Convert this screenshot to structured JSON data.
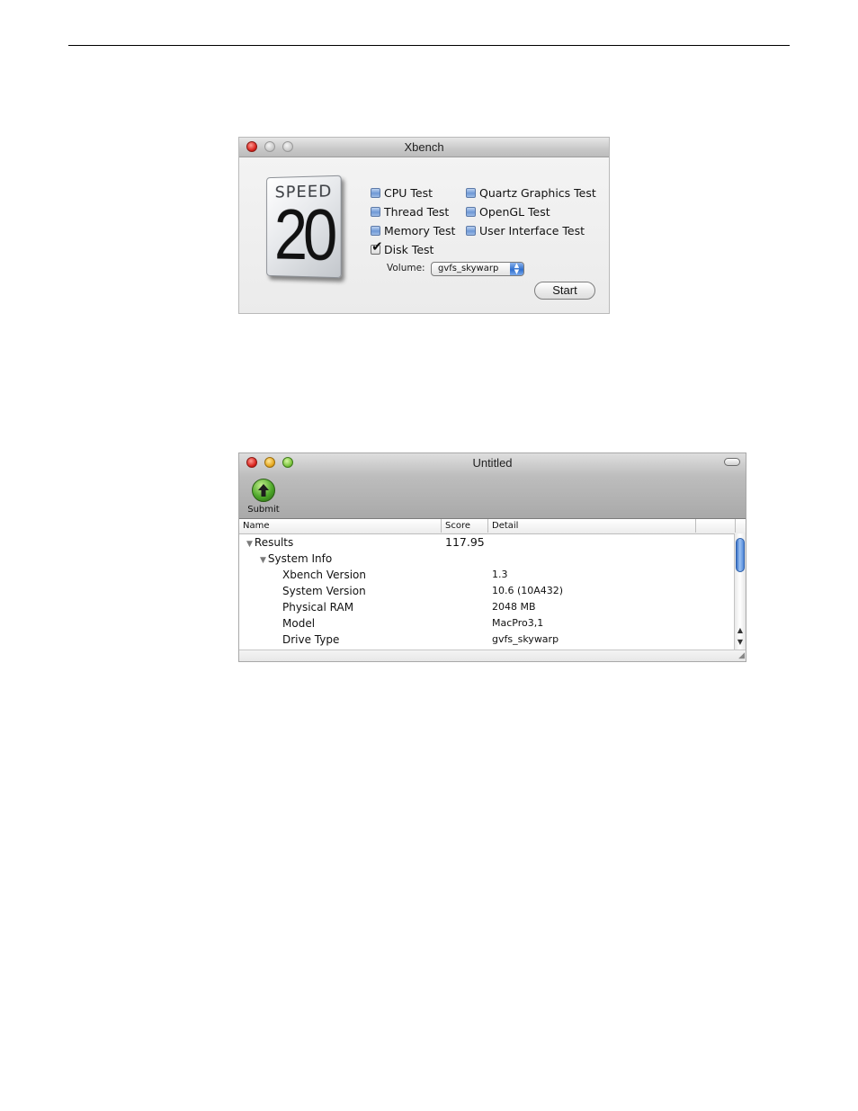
{
  "xbench_window": {
    "title": "Xbench",
    "logo": {
      "word": "SPEED",
      "number": "20"
    },
    "tests_left": [
      {
        "label": "CPU Test",
        "checked": false
      },
      {
        "label": "Thread Test",
        "checked": false
      },
      {
        "label": "Memory Test",
        "checked": false
      },
      {
        "label": "Disk Test",
        "checked": true
      }
    ],
    "tests_right": [
      {
        "label": "Quartz Graphics Test",
        "checked": false
      },
      {
        "label": "OpenGL Test",
        "checked": false
      },
      {
        "label": "User Interface Test",
        "checked": false
      }
    ],
    "volume_label": "Volume:",
    "volume_value": "gvfs_skywarp",
    "start_label": "Start"
  },
  "results_window": {
    "title": "Untitled",
    "submit_label": "Submit",
    "columns": {
      "name": "Name",
      "score": "Score",
      "detail": "Detail"
    },
    "rows": [
      {
        "name": "Results",
        "score": "117.95",
        "detail": "",
        "level": 0,
        "disclosure": "open"
      },
      {
        "name": "System Info",
        "score": "",
        "detail": "",
        "level": 1,
        "disclosure": "open"
      },
      {
        "name": "Xbench Version",
        "score": "",
        "detail": "1.3",
        "level": 2
      },
      {
        "name": "System Version",
        "score": "",
        "detail": "10.6 (10A432)",
        "level": 2
      },
      {
        "name": "Physical RAM",
        "score": "",
        "detail": "2048 MB",
        "level": 2
      },
      {
        "name": "Model",
        "score": "",
        "detail": "MacPro3,1",
        "level": 2
      },
      {
        "name": "Drive Type",
        "score": "",
        "detail": "gvfs_skywarp",
        "level": 2
      }
    ]
  },
  "icons": {
    "close": "close-icon",
    "minimize": "minimize-icon",
    "zoom": "zoom-icon",
    "submit": "upload-arrow-icon",
    "disclosure": "disclosure-triangle-icon"
  },
  "colors": {
    "close_red": "#d8201a",
    "minimize_yellow": "#e4a61d",
    "zoom_green": "#78c23a",
    "checkbox_blue": "#6e98d6",
    "scroll_thumb_blue": "#3a72c9"
  }
}
